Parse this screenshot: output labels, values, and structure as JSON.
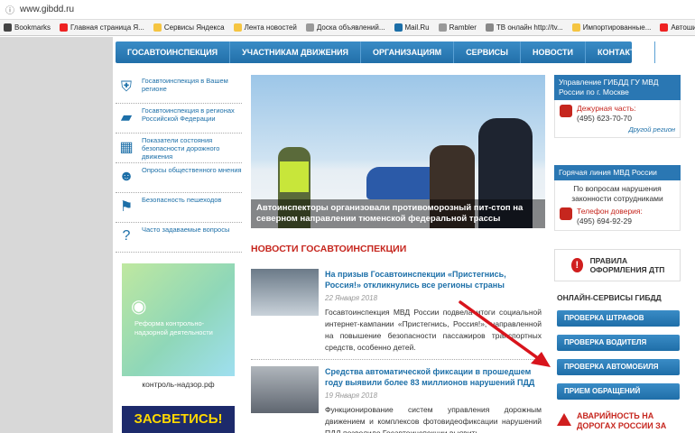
{
  "browser": {
    "url": "www.gibdd.ru",
    "bookmarks": [
      {
        "label": "Bookmarks",
        "color": "#444"
      },
      {
        "label": "Главная страница Я...",
        "color": "#e22"
      },
      {
        "label": "Сервисы Яндекса",
        "color": "#f5c542"
      },
      {
        "label": "Лента новостей",
        "color": "#f5c542"
      },
      {
        "label": "Доска объявлений...",
        "color": "#999"
      },
      {
        "label": "Mail.Ru",
        "color": "#1c6fa8"
      },
      {
        "label": "Rambler",
        "color": "#999"
      },
      {
        "label": "ТВ онлайн http://tv...",
        "color": "#888"
      },
      {
        "label": "Импортированные...",
        "color": "#f5c542"
      },
      {
        "label": "Автошины | Кули...",
        "color": "#e22"
      }
    ]
  },
  "nav": [
    "ГОСАВТОИНСПЕКЦИЯ",
    "УЧАСТНИКАМ ДВИЖЕНИЯ",
    "ОРГАНИЗАЦИЯМ",
    "СЕРВИСЫ",
    "НОВОСТИ",
    "КОНТАКТЫ"
  ],
  "sidebar": [
    {
      "label": "Госавтоинспекция в Вашем регионе",
      "icon": "emblem-icon"
    },
    {
      "label": "Госавтоинспекция в регионах Российской Федерации",
      "icon": "russia-map-icon"
    },
    {
      "label": "Показатели состояния безопасности дорожного движения",
      "icon": "stats-icon"
    },
    {
      "label": "Опросы общественного мнения",
      "icon": "people-icon"
    },
    {
      "label": "Безопасность пешеходов",
      "icon": "pedestrian-icon"
    },
    {
      "label": "Часто задаваемые вопросы",
      "icon": "question-icon"
    }
  ],
  "promo": {
    "text": "Реформа контрольно-надзорной деятельности",
    "caption": "контроль-надзор.рф",
    "banner2": "ЗАСВЕТИСЬ!"
  },
  "hero": {
    "caption": "Автоинспекторы организовали противоморозный пит-стоп на северном направлении тюменской федеральной трассы"
  },
  "news_heading": "НОВОСТИ ГОСАВТОИНСПЕКЦИИ",
  "news": [
    {
      "title": "На призыв Госавтоинспекции «Пристегнись, Россия!» откликнулись все регионы страны",
      "date": "22 Января 2018",
      "body": "Госавтоинспекция МВД России подвела итоги социальной интернет-кампании «Пристегнись, Россия!», направленной на повышение безопасности пассажиров транспортных средств, особенно детей."
    },
    {
      "title": "Средства автоматической фиксации в прошедшем году выявили более 83 миллионов нарушений ПДД",
      "date": "19 Января 2018",
      "body": "Функционирование систем управления дорожным движением и комплексов фотовидеофиксации нарушений ПДД позволило Госавтоинспекции выявить"
    }
  ],
  "right": {
    "moscow_head": "Управление ГИБДД ГУ МВД России по г. Москве",
    "duty_label": "Дежурная часть:",
    "duty_phone": "(495) 623-70-70",
    "other_region": "Другой регион",
    "hotline_head": "Горячая линия МВД России",
    "hotline_text": "По вопросам нарушения законности сотрудниками",
    "trust_label": "Телефон доверия:",
    "trust_phone": "(495) 694-92-29",
    "dtp": "ПРАВИЛА ОФОРМЛЕНИЯ ДТП",
    "services_head": "ОНЛАЙН-СЕРВИСЫ ГИБДД",
    "services": [
      "ПРОВЕРКА ШТРАФОВ",
      "ПРОВЕРКА ВОДИТЕЛЯ",
      "ПРОВЕРКА АВТОМОБИЛЯ",
      "ПРИЕМ ОБРАЩЕНИЙ"
    ],
    "alert": "АВАРИЙНОСТЬ НА ДОРОГАХ РОССИИ ЗА"
  },
  "colors": {
    "accent": "#2a77b3",
    "red": "#c6261e",
    "annotation_arrow": "#d8141c"
  }
}
